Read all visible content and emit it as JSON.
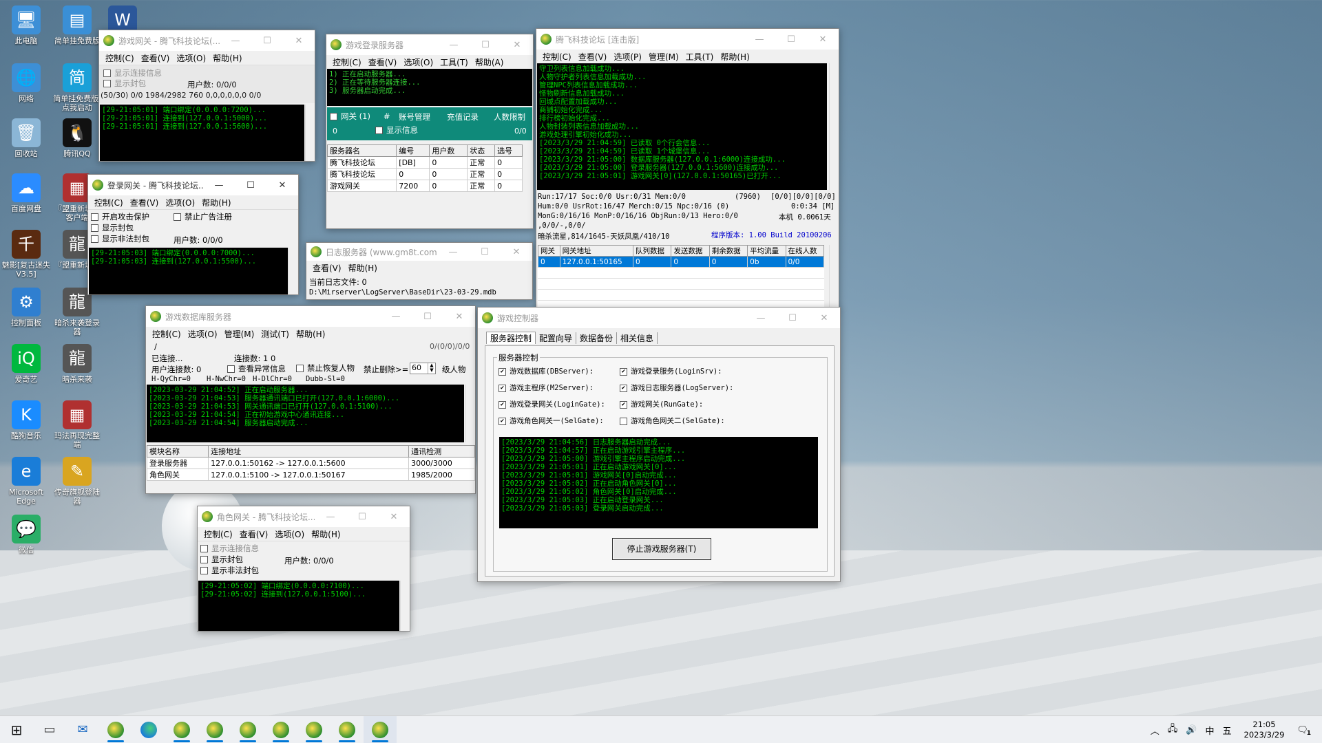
{
  "desktop_icons": [
    {
      "label": "此电脑",
      "icon": "computer-icon",
      "color": "#3d8fd6"
    },
    {
      "label": "网络",
      "icon": "network-icon",
      "color": "#3d8fd6"
    },
    {
      "label": "回收站",
      "icon": "recycle-bin-icon",
      "color": "#8bb6d6"
    },
    {
      "label": "百度网盘",
      "icon": "baidu-netdisk-icon",
      "color": "#2b8cff"
    },
    {
      "label": "魅影[复古迷失V3.5]",
      "icon": "game-icon",
      "color": "#5a2a10"
    },
    {
      "label": "控制面板",
      "icon": "control-panel-icon",
      "color": "#2f7fd0"
    },
    {
      "label": "爱奇艺",
      "icon": "iqiyi-icon",
      "color": "#00b83f"
    },
    {
      "label": "酷狗音乐",
      "icon": "kugou-icon",
      "color": "#1a8cff"
    },
    {
      "label": "Microsoft Edge",
      "icon": "edge-icon",
      "color": "#1a7dd8"
    },
    {
      "label": "微信",
      "icon": "wechat-icon",
      "color": "#2aae67"
    },
    {
      "label": "简单挂免费版",
      "icon": "file-icon",
      "color": "#3a8fd6"
    },
    {
      "label": "简单挂免费版,点我启动",
      "icon": "jiandan-icon",
      "color": "#1aa0d8"
    },
    {
      "label": "腾讯QQ",
      "icon": "qq-icon",
      "color": "#111111"
    },
    {
      "label": "『盟重新城』客户端",
      "icon": "winrar-icon",
      "color": "#b03030"
    },
    {
      "label": "『盟重新城』",
      "icon": "dragon-icon",
      "color": "#555555"
    },
    {
      "label": "暗杀来袭登录器",
      "icon": "dragon-icon",
      "color": "#555555"
    },
    {
      "label": "暗杀来袭",
      "icon": "dragon-icon",
      "color": "#555555"
    },
    {
      "label": "玛法再现完整端",
      "icon": "winrar-icon",
      "color": "#b03030"
    },
    {
      "label": "传奇旗舰登陆器",
      "icon": "launcher-icon",
      "color": "#d9a520"
    },
    {
      "label": "W",
      "icon": "word-icon",
      "color": "#2b579a"
    }
  ],
  "w_gate": {
    "title": "游戏网关 - 腾飞科技论坛(...",
    "menu": [
      "控制(C)",
      "查看(V)",
      "选项(O)",
      "帮助(H)"
    ],
    "chk1": "显示连接信息",
    "chk2": "显示封包",
    "users": "用户数: 0/0/0",
    "stats": "(50/30) 0/0 1984/2982  760 0,0,0,0,0,0 0/0",
    "log": [
      "[29-21:05:01] 端口绑定(0.0.0.0:7200)...",
      "[29-21:05:01] 连接到(127.0.0.1:5000)...",
      "[29-21:05:01] 连接到(127.0.0.1:5600)..."
    ]
  },
  "w_login_gate": {
    "title": "登录网关 - 腾飞科技论坛...",
    "menu": [
      "控制(C)",
      "查看(V)",
      "选项(O)",
      "帮助(H)"
    ],
    "chk1": "开启攻击保护",
    "chk2": "禁止广告注册",
    "chk3": "显示封包",
    "chk4": "显示非法封包",
    "users": "用户数: 0/0/0",
    "log": [
      "[29-21:05:03] 端口绑定(0.0.0.0:7000)...",
      "[29-21:05:03] 连接到(127.0.0.1:5500)..."
    ]
  },
  "w_login_server": {
    "title": "游戏登录服务器",
    "menu": [
      "控制(C)",
      "查看(V)",
      "选项(O)",
      "工具(T)",
      "帮助(A)"
    ],
    "log": [
      "1) 正在启动服务器...",
      "2) 正在等待服务器连接...",
      "3) 服务器启动完成..."
    ],
    "tab_gate": "网关 (1)",
    "hash": "#",
    "tab_acc": "账号管理",
    "tab_pay": "充值记录",
    "tab_limit": "人数限制",
    "zero": "0",
    "chk_show": "显示信息",
    "count": "0/0",
    "headers": [
      "服务器名",
      "编号",
      "用户数",
      "状态",
      "选号"
    ],
    "rows": [
      [
        "腾飞科技论坛",
        "[DB]",
        "0",
        "正常",
        "0"
      ],
      [
        "腾飞科技论坛",
        "0",
        "0",
        "正常",
        "0"
      ],
      [
        "游戏网关",
        "7200",
        "0",
        "正常",
        "0"
      ]
    ]
  },
  "w_log_server": {
    "title": "日志服务器 (www.gm8t.com)",
    "menu": [
      "查看(V)",
      "帮助(H)"
    ],
    "line1": "当前日志文件: 0",
    "line2": "D:\\Mirserver\\LogServer\\BaseDir\\23-03-29.mdb"
  },
  "w_main": {
    "title": "腾飞科技论坛 [连击版]",
    "menu": [
      "控制(C)",
      "查看(V)",
      "选项(P)",
      "管理(M)",
      "工具(T)",
      "帮助(H)"
    ],
    "log": [
      "守卫列表信息加载成功...",
      "人物守护者列表信息加载成功...",
      "管理NPC列表信息加载成功...",
      "怪物刷新信息加载成功...",
      "回城点配置加载成功...",
      "商铺初始化完成...",
      "排行榜初始化完成...",
      "人物封装列表信息加载成功...",
      "游戏处理引擎初始化成功...",
      "[2023/3/29 21:04:59] 已读取 0个行会信息...",
      "[2023/3/29 21:04:59] 已读取 1个城堡信息...",
      "[2023/3/29 21:05:00] 数据库服务器(127.0.0.1:6000)连接成功...",
      "[2023/3/29 21:05:00] 登录服务器(127.0.0.1:5600)连接成功...",
      "[2023/3/29 21:05:01] 游戏网关[0](127.0.0.1:50165)已打开..."
    ],
    "st1": "Run:17/17 Soc:0/0 Usr:0/31 Mem:0/0",
    "st1b": "(7960)",
    "st1c": "[0/0][0/0][0/0]",
    "st2": "Hum:0/0 UsrRot:16/47 Merch:0/15 Npc:0/16 (0)",
    "st2b": "0:0:34 [M]",
    "st3": "MonG:0/16/16 MonP:0/16/16 ObjRun:0/13 Hero:0/0",
    "st3b": "本机 0.0061天",
    "st4": ",0/0/-,0/0/",
    "st5": "暗杀流星,814/1645-天妖凤凰/410/10",
    "ver": "程序版本: 1.00 Build 20100206",
    "headers": [
      "网关",
      "网关地址",
      "队列数据",
      "发送数据",
      "剩余数据",
      "平均流量",
      "在线人数"
    ],
    "rows": [
      [
        "0",
        "127.0.0.1:50165",
        "0",
        "0",
        "0",
        "0b",
        "0/0"
      ]
    ]
  },
  "w_db": {
    "title": "游戏数据库服务器",
    "menu": [
      "控制(C)",
      "选项(O)",
      "管理(M)",
      "测试(T)",
      "帮助(H)"
    ],
    "slash": "/",
    "counter": "0/(0/0)/0/0",
    "connected": "已连接...",
    "conn_count": "连接数: 1   0",
    "user_conn": "用户连接数: 0",
    "chk_abn": "查看异常信息",
    "chk_nores": "禁止恢复人物",
    "lbl_del": "禁止删除>=",
    "del_val": "60",
    "lbl_lvl": "级人物",
    "hq": "H-QyChr=0",
    "hn": "H-NwChr=0",
    "hd": "H-DlChr=0",
    "dubb": "Dubb-Sl=0",
    "log": [
      "[2023-03-29 21:04:52] 正在启动服务器...",
      "[2023-03-29 21:04:53] 服务器通讯端口已打开(127.0.0.1:6000)...",
      "[2023-03-29 21:04:53] 网关通讯端口已打开(127.0.0.1:5100)...",
      "[2023-03-29 21:04:54] 正在初始游戏中心通讯连接...",
      "[2023-03-29 21:04:54] 服务器启动完成..."
    ],
    "headers": [
      "模块名称",
      "连接地址",
      "通讯检测"
    ],
    "rows": [
      [
        "登录服务器",
        "127.0.0.1:50162 -> 127.0.0.1:5600",
        "3000/3000"
      ],
      [
        "角色网关",
        "127.0.0.1:5100 -> 127.0.0.1:50167",
        "1985/2000"
      ]
    ]
  },
  "w_char_gate": {
    "title": "角色网关 - 腾飞科技论坛...",
    "menu": [
      "控制(C)",
      "查看(V)",
      "选项(O)",
      "帮助(H)"
    ],
    "chk1": "显示连接信息",
    "chk2": "显示封包",
    "chk3": "显示非法封包",
    "users": "用户数: 0/0/0",
    "log": [
      "[29-21:05:02] 端口绑定(0.0.0.0:7100)...",
      "[29-21:05:02] 连接到(127.0.0.1:5100)..."
    ]
  },
  "w_ctrl": {
    "title": "游戏控制器",
    "tabs": [
      "服务器控制",
      "配置向导",
      "数据备份",
      "相关信息"
    ],
    "group": "服务器控制",
    "items": [
      "游戏数据库(DBServer):",
      "游戏登录服务(LoginSrv):",
      "游戏主程序(M2Server):",
      "游戏日志服务器(LogServer):",
      "游戏登录网关(LoginGate):",
      "游戏网关(RunGate):",
      "游戏角色网关一(SelGate):",
      "游戏角色网关二(SelGate):"
    ],
    "log": [
      "[2023/3/29 21:04:56] 日志服务器启动完成...",
      "[2023/3/29 21:04:57] 正在启动游戏引擎主程序...",
      "[2023/3/29 21:05:00] 游戏引擎主程序启动完成...",
      "[2023/3/29 21:05:01] 正在启动游戏网关[0]...",
      "[2023/3/29 21:05:01] 游戏网关[0]启动完成...",
      "[2023/3/29 21:05:02] 正在启动角色网关[0]...",
      "[2023/3/29 21:05:02] 角色网关[0]启动完成...",
      "[2023/3/29 21:05:03] 正在启动登录网关...",
      "[2023/3/29 21:05:03] 登录网关启动完成..."
    ],
    "stop_btn": "停止游戏服务器(T)"
  },
  "taskbar": {
    "ime": "中",
    "ime2": "五",
    "time": "21:05",
    "date": "2023/3/29",
    "notif": "1"
  }
}
